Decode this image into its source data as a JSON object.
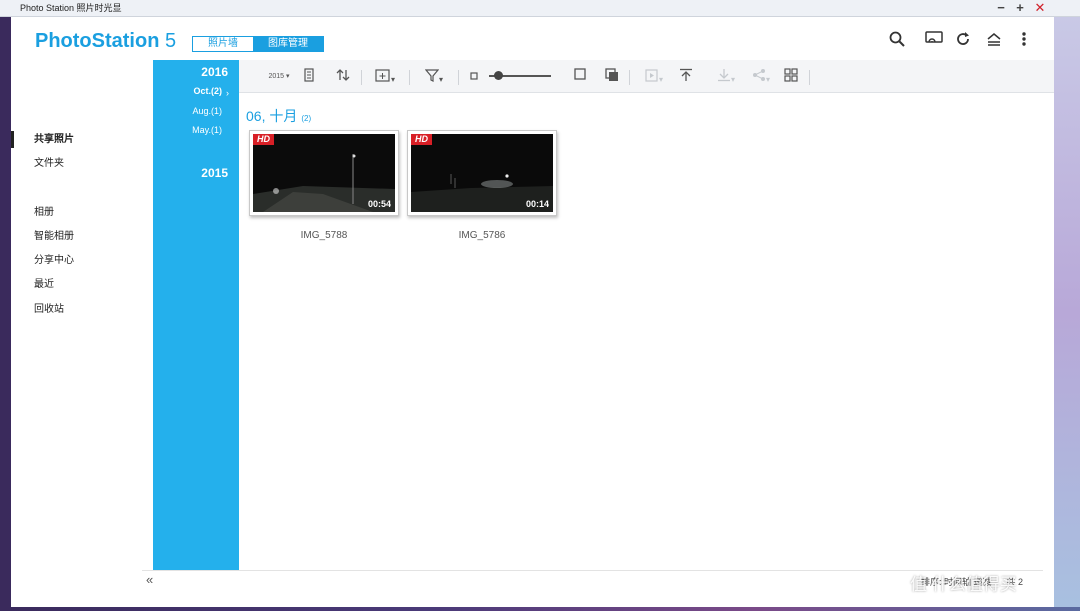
{
  "window": {
    "title": "Photo Station 照片时光显",
    "min_glyph": "−",
    "max_glyph": "+",
    "close_glyph": "✕"
  },
  "header": {
    "logo_bold": "PhotoStation",
    "logo_light": " 5",
    "tabs": [
      "照片墙",
      "图库管理"
    ],
    "active_tab": "图库管理",
    "icons": [
      "search-icon",
      "cast-icon",
      "refresh-icon",
      "upload-queue-icon",
      "more-icon"
    ]
  },
  "nav": {
    "items": [
      {
        "label": "共享照片",
        "active": true
      },
      {
        "label": "文件夹"
      },
      {
        "label": "相册"
      },
      {
        "label": "智能相册"
      },
      {
        "label": "分享中心"
      },
      {
        "label": "最近"
      },
      {
        "label": "回收站"
      }
    ]
  },
  "timeline": {
    "years": [
      "2016",
      "2015"
    ],
    "months": [
      {
        "label": "Oct.(2)",
        "active": true
      },
      {
        "label": "Aug.(1)"
      },
      {
        "label": "May.(1)"
      }
    ],
    "arrow": "›"
  },
  "toolbar": {
    "icons": [
      "timeline-view-icon",
      "list-view-icon",
      "sort-icon",
      "add-icon",
      "filter-icon",
      "small-size-icon",
      "size-slider",
      "large-size-icon",
      "multi-select-icon",
      "slideshow-icon",
      "upload-icon",
      "download-icon",
      "share-icon",
      "grid-icon"
    ],
    "disabled": [
      "slideshow-icon",
      "download-icon",
      "share-icon"
    ],
    "timeline_glyph": "2015",
    "zoom_level": 0.15
  },
  "content": {
    "group_title": "06, 十月",
    "group_count": "(2)",
    "items": [
      {
        "name": "IMG_5788",
        "badge": "HD",
        "duration": "00:54"
      },
      {
        "name": "IMG_5786",
        "badge": "HD",
        "duration": "00:14"
      }
    ]
  },
  "footer": {
    "collapse": "«",
    "status": "排序: 时间轴 递减",
    "count": "共 2"
  },
  "watermark": "值 什么值得买"
}
